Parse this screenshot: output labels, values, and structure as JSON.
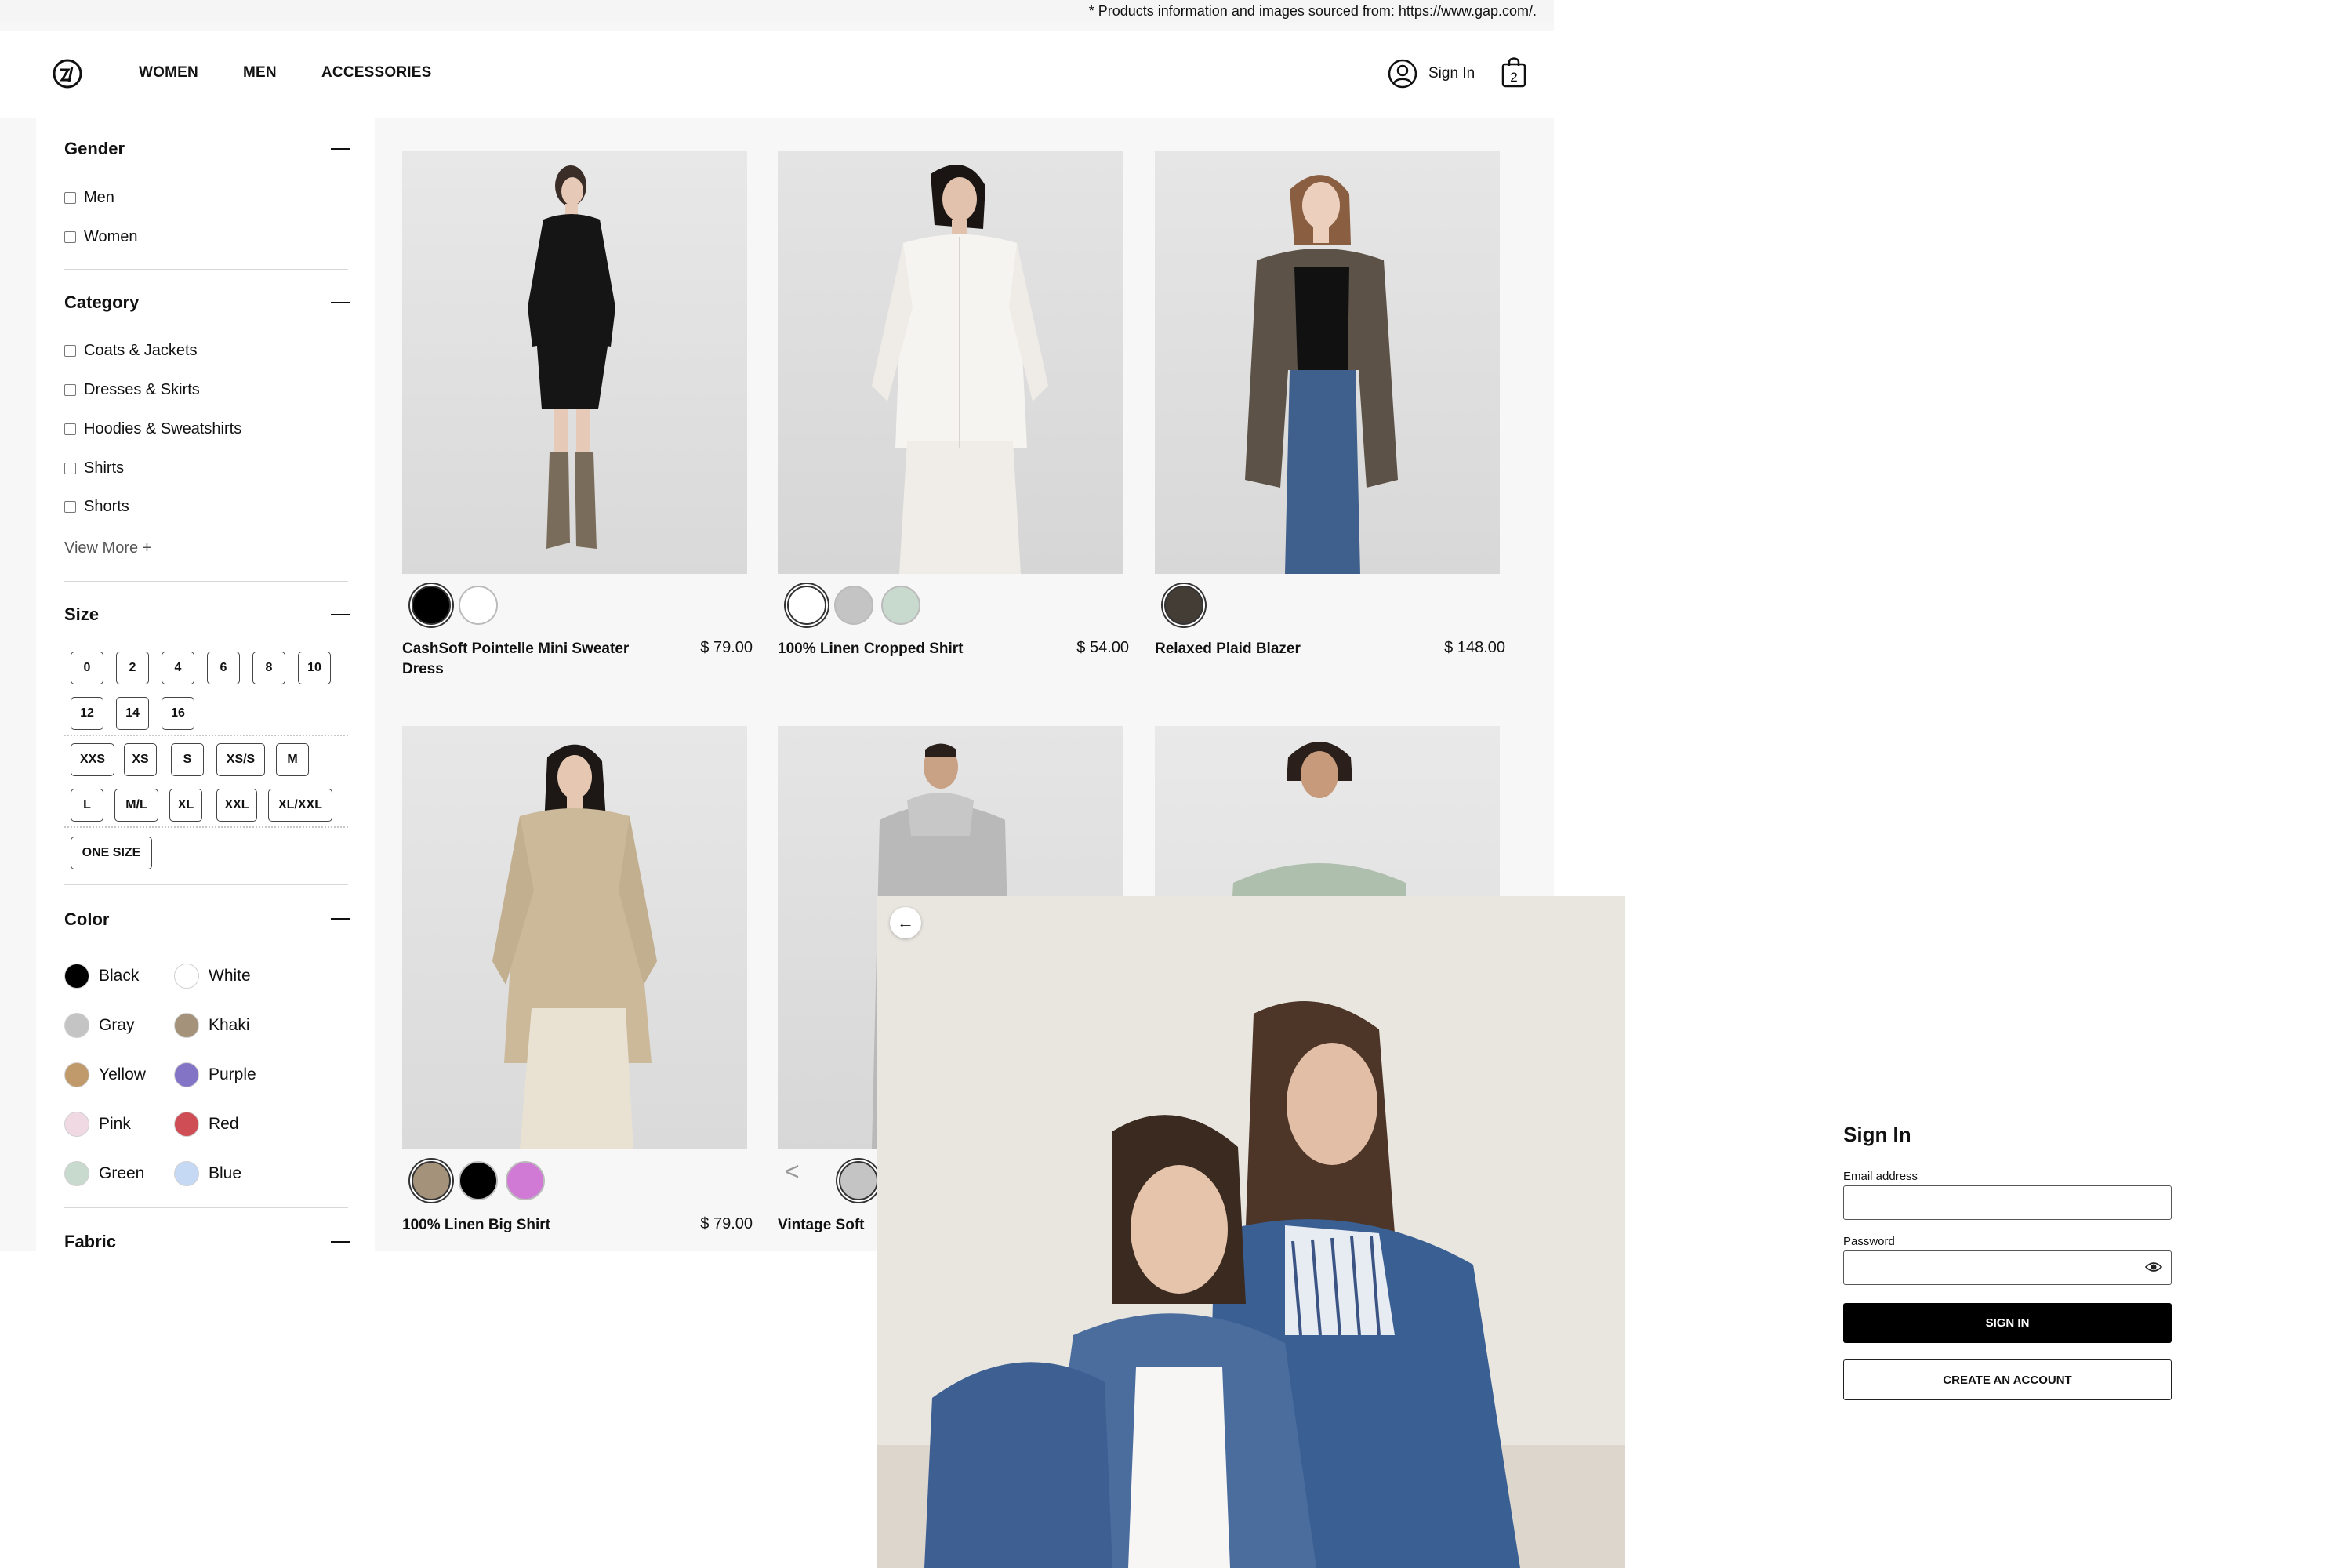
{
  "banner": {
    "text": "* Products information and images sourced from: https://www.gap.com/."
  },
  "header": {
    "nav": [
      "WOMEN",
      "MEN",
      "ACCESSORIES"
    ],
    "sign_in": "Sign In",
    "bag_count": "2",
    "icons": {
      "logo": "brand-logo-icon",
      "account": "user-circle-icon",
      "bag": "shopping-bag-icon"
    }
  },
  "filters": {
    "gender": {
      "title": "Gender",
      "options": [
        "Men",
        "Women"
      ]
    },
    "category": {
      "title": "Category",
      "options": [
        "Coats & Jackets",
        "Dresses & Skirts",
        "Hoodies & Sweatshirts",
        "Shirts",
        "Shorts"
      ],
      "view_more": "View More +"
    },
    "size": {
      "title": "Size",
      "numeric_row1": [
        "0",
        "2",
        "4",
        "6",
        "8",
        "10"
      ],
      "numeric_row2": [
        "12",
        "14",
        "16"
      ],
      "alpha_row1": [
        "XXS",
        "XS",
        "S",
        "XS/S",
        "M"
      ],
      "alpha_row2": [
        "L",
        "M/L",
        "XL",
        "XXL",
        "XL/XXL"
      ],
      "one_size": "ONE SIZE"
    },
    "color": {
      "title": "Color",
      "options": [
        {
          "name": "Black",
          "hex": "#000000"
        },
        {
          "name": "White",
          "hex": "#ffffff"
        },
        {
          "name": "Gray",
          "hex": "#c4c4c4"
        },
        {
          "name": "Khaki",
          "hex": "#a5927b"
        },
        {
          "name": "Yellow",
          "hex": "#c19a6b"
        },
        {
          "name": "Purple",
          "hex": "#8474c6"
        },
        {
          "name": "Pink",
          "hex": "#f1d9e3"
        },
        {
          "name": "Red",
          "hex": "#cf4d55"
        },
        {
          "name": "Green",
          "hex": "#c8d9cd"
        },
        {
          "name": "Blue",
          "hex": "#c5d9f4"
        }
      ]
    },
    "fabric": {
      "title": "Fabric"
    }
  },
  "products": [
    {
      "name": "CashSoft Pointelle Mini Sweater Dress",
      "price": "$ 79.00",
      "swatches": [
        "#000000",
        "#ffffff"
      ]
    },
    {
      "name": "100% Linen Cropped Shirt",
      "price": "$ 54.00",
      "swatches": [
        "#ffffff",
        "#c4c4c4",
        "#c8d9cd"
      ]
    },
    {
      "name": "Relaxed Plaid Blazer",
      "price": "$ 148.00",
      "swatches": [
        "#433d36"
      ]
    },
    {
      "name": "100% Linen Big Shirt",
      "price": "$ 79.00",
      "swatches": [
        "#a5927b",
        "#000000",
        "#d07ad6"
      ]
    },
    {
      "name": "Vintage Soft",
      "price": "",
      "swatches": [
        "#c4c4c4"
      ]
    }
  ],
  "signin": {
    "title": "Sign In",
    "email_label": "Email address",
    "password_label": "Password",
    "submit": "SIGN IN",
    "create": "CREATE AN ACCOUNT"
  }
}
